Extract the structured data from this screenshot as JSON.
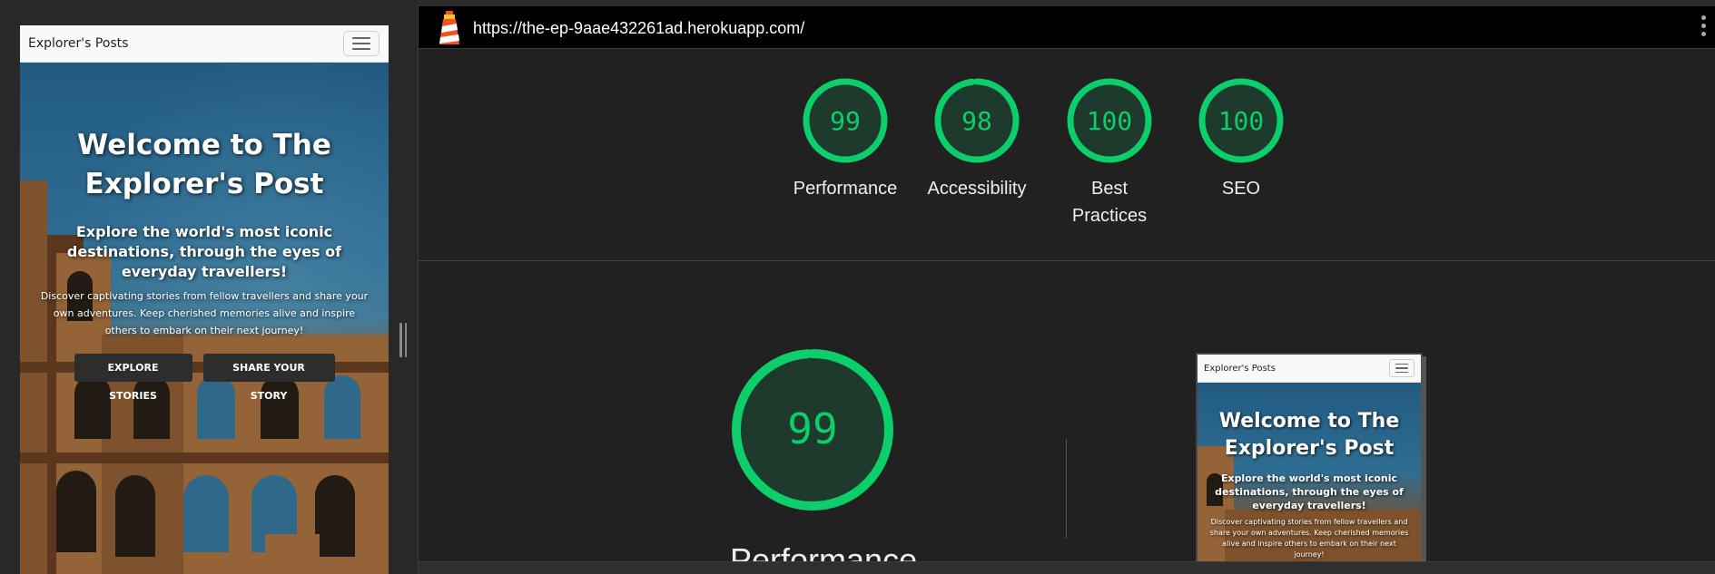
{
  "mobile_preview": {
    "brand": "Explorer's Posts",
    "hero_title": "Welcome to The Explorer's Post",
    "hero_subtitle": "Explore the world's most iconic destinations, through the eyes of everyday travellers!",
    "hero_description": "Discover captivating stories from fellow travellers and share your own adventures. Keep cherished memories alive and inspire others to embark on their next journey!",
    "buttons": {
      "explore": "EXPLORE STORIES",
      "share": "SHARE YOUR STORY"
    }
  },
  "report": {
    "url": "https://the-ep-9aae432261ad.herokuapp.com/",
    "scores": [
      {
        "value": "99",
        "fraction": 0.99,
        "label": "Performance"
      },
      {
        "value": "98",
        "fraction": 0.98,
        "label": "Accessibility"
      },
      {
        "value": "100",
        "fraction": 1.0,
        "label": "Best Practices"
      },
      {
        "value": "100",
        "fraction": 1.0,
        "label": "SEO"
      }
    ],
    "performance_score": {
      "value": "99",
      "fraction": 0.99
    },
    "colors": {
      "pass": "#0cce6b",
      "pass_fill": "#1e3a2c"
    }
  },
  "screenshot_thumbnail": {
    "brand": "Explorer's Posts",
    "hero_title": "Welcome to The Explorer's Post",
    "hero_subtitle": "Explore the world's most iconic destinations, through the eyes of everyday travellers!",
    "hero_description": "Discover captivating stories from fellow travellers and share your own adventures. Keep cherished memories alive and inspire others to embark on their next journey!"
  },
  "icons": [
    "hamburger-menu-icon",
    "lighthouse-logo-icon",
    "kebab-menu-icon",
    "resize-handle-icon"
  ]
}
